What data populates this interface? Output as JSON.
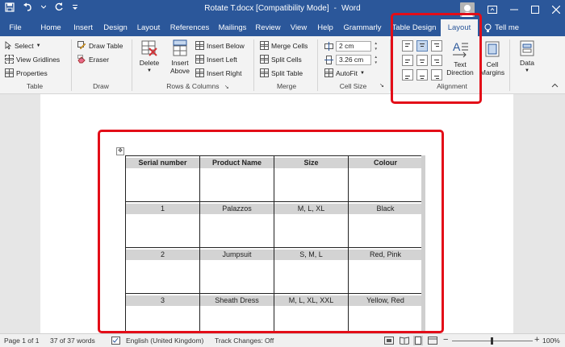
{
  "window": {
    "title": "Rotate T.docx [Compatibility Mode]",
    "separator": "-",
    "app_name": "Word"
  },
  "tabs": [
    {
      "label": "File"
    },
    {
      "label": "Home"
    },
    {
      "label": "Insert"
    },
    {
      "label": "Design"
    },
    {
      "label": "Layout"
    },
    {
      "label": "References"
    },
    {
      "label": "Mailings"
    },
    {
      "label": "Review"
    },
    {
      "label": "View"
    },
    {
      "label": "Help"
    },
    {
      "label": "Grammarly"
    },
    {
      "label": "Table Design"
    },
    {
      "label": "Layout",
      "active": true
    }
  ],
  "tell_me": "Tell me",
  "ribbon": {
    "table": {
      "select": "Select",
      "view_gridlines": "View Gridlines",
      "properties": "Properties",
      "group": "Table"
    },
    "draw": {
      "draw_table": "Draw Table",
      "eraser": "Eraser",
      "group": "Draw"
    },
    "rows_columns": {
      "delete": "Delete",
      "insert_above_1": "Insert",
      "insert_above_2": "Above",
      "insert_below": "Insert Below",
      "insert_left": "Insert Left",
      "insert_right": "Insert Right",
      "group": "Rows & Columns"
    },
    "merge": {
      "merge_cells": "Merge Cells",
      "split_cells": "Split Cells",
      "split_table": "Split Table",
      "group": "Merge"
    },
    "cell_size": {
      "height": "2 cm",
      "width": "3.26 cm",
      "autofit": "AutoFit",
      "group": "Cell Size"
    },
    "alignment": {
      "text_direction_1": "Text",
      "text_direction_2": "Direction",
      "cell_margins_1": "Cell",
      "cell_margins_2": "Margins",
      "group": "Alignment"
    },
    "data": {
      "label": "Data"
    }
  },
  "doc_table": {
    "headers": [
      "Serial number",
      "Product Name",
      "Size",
      "Colour"
    ],
    "rows": [
      [
        "1",
        "Palazzos",
        "M, L, XL",
        "Black"
      ],
      [
        "2",
        "Jumpsuit",
        "S, M, L",
        "Red, Pink"
      ],
      [
        "3",
        "Sheath Dress",
        "M, L, XL, XXL",
        "Yellow, Red"
      ]
    ]
  },
  "status": {
    "page": "Page 1 of 1",
    "words": "37 of 37 words",
    "language": "English (United Kingdom)",
    "track_changes": "Track Changes: Off",
    "zoom": "100%"
  },
  "colors": {
    "accent": "#2b579a",
    "highlight": "#e30d18"
  }
}
